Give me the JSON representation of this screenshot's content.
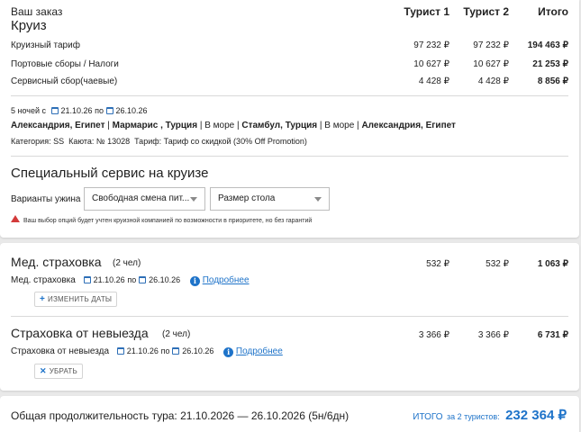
{
  "order": {
    "title": "Ваш заказ",
    "columns": [
      "Турист 1",
      "Турист 2",
      "Итого"
    ],
    "section_title": "Круиз",
    "rows": [
      {
        "label": "Круизный тариф",
        "t1": "97 232 ₽",
        "t2": "97 232 ₽",
        "total": "194 463 ₽"
      },
      {
        "label": "Портовые сборы / Налоги",
        "t1": "10 627 ₽",
        "t2": "10 627 ₽",
        "total": "21 253 ₽"
      },
      {
        "label": "Сервисный сбор(чаевые)",
        "t1": "4 428 ₽",
        "t2": "4 428 ₽",
        "total": "8 856 ₽"
      }
    ],
    "nights_prefix": "5 ночей с",
    "date_from": "21.10.26",
    "date_sep": "по",
    "date_to": "26.10.26",
    "route": [
      {
        "text": "Александрия, Египет",
        "bold": true
      },
      {
        "text": " | ",
        "bold": false
      },
      {
        "text": "Мармарис , Турция",
        "bold": true
      },
      {
        "text": " | В море | ",
        "bold": false
      },
      {
        "text": "Стамбул, Турция",
        "bold": true
      },
      {
        "text": " | В море | ",
        "bold": false
      },
      {
        "text": "Александрия, Египет",
        "bold": true
      }
    ],
    "category_line": "Категория: SS  Каюта: № 13028  Тариф: Тариф со скидкой (30% Off Promotion)"
  },
  "special_service": {
    "title": "Специальный сервис на круизе",
    "dinner_label": "Варианты ужина",
    "dinner_select": "Свободная смена пит...",
    "table_select": "Размер стола",
    "warning": "Ваш выбор опций будет учтен круизной компанией по возможности в приоритете, но без гарантий"
  },
  "med_insurance": {
    "title": "Мед. страховка",
    "people": "(2 чел)",
    "t1": "532 ₽",
    "t2": "532 ₽",
    "total": "1 063 ₽",
    "sub_label": "Мед. страховка",
    "date_from": "21.10.26",
    "date_sep": "по",
    "date_to": "26.10.26",
    "details_link": "Подробнее",
    "change_dates_button": "ИЗМЕНИТЬ ДАТЫ"
  },
  "trip_insurance": {
    "title": "Страховка от невыезда",
    "people": "(2 чел)",
    "t1": "3 366 ₽",
    "t2": "3 366 ₽",
    "total": "6 731 ₽",
    "sub_label": "Страховка от невыезда",
    "date_from": "21.10.26",
    "date_sep": "по",
    "date_to": "26.10.26",
    "details_link": "Подробнее",
    "remove_button": "УБРАТЬ"
  },
  "footer": {
    "duration": "Общая продолжительность тура: 21.10.2026 — 26.10.2026 (5н/6дн)",
    "total_label": "ИТОГО",
    "total_for": "за 2 туристов:",
    "total_value": "232 364 ₽"
  },
  "colors": {
    "accent": "#1e73c9",
    "warning": "#d33a3a",
    "background": "#e9e9e9"
  }
}
